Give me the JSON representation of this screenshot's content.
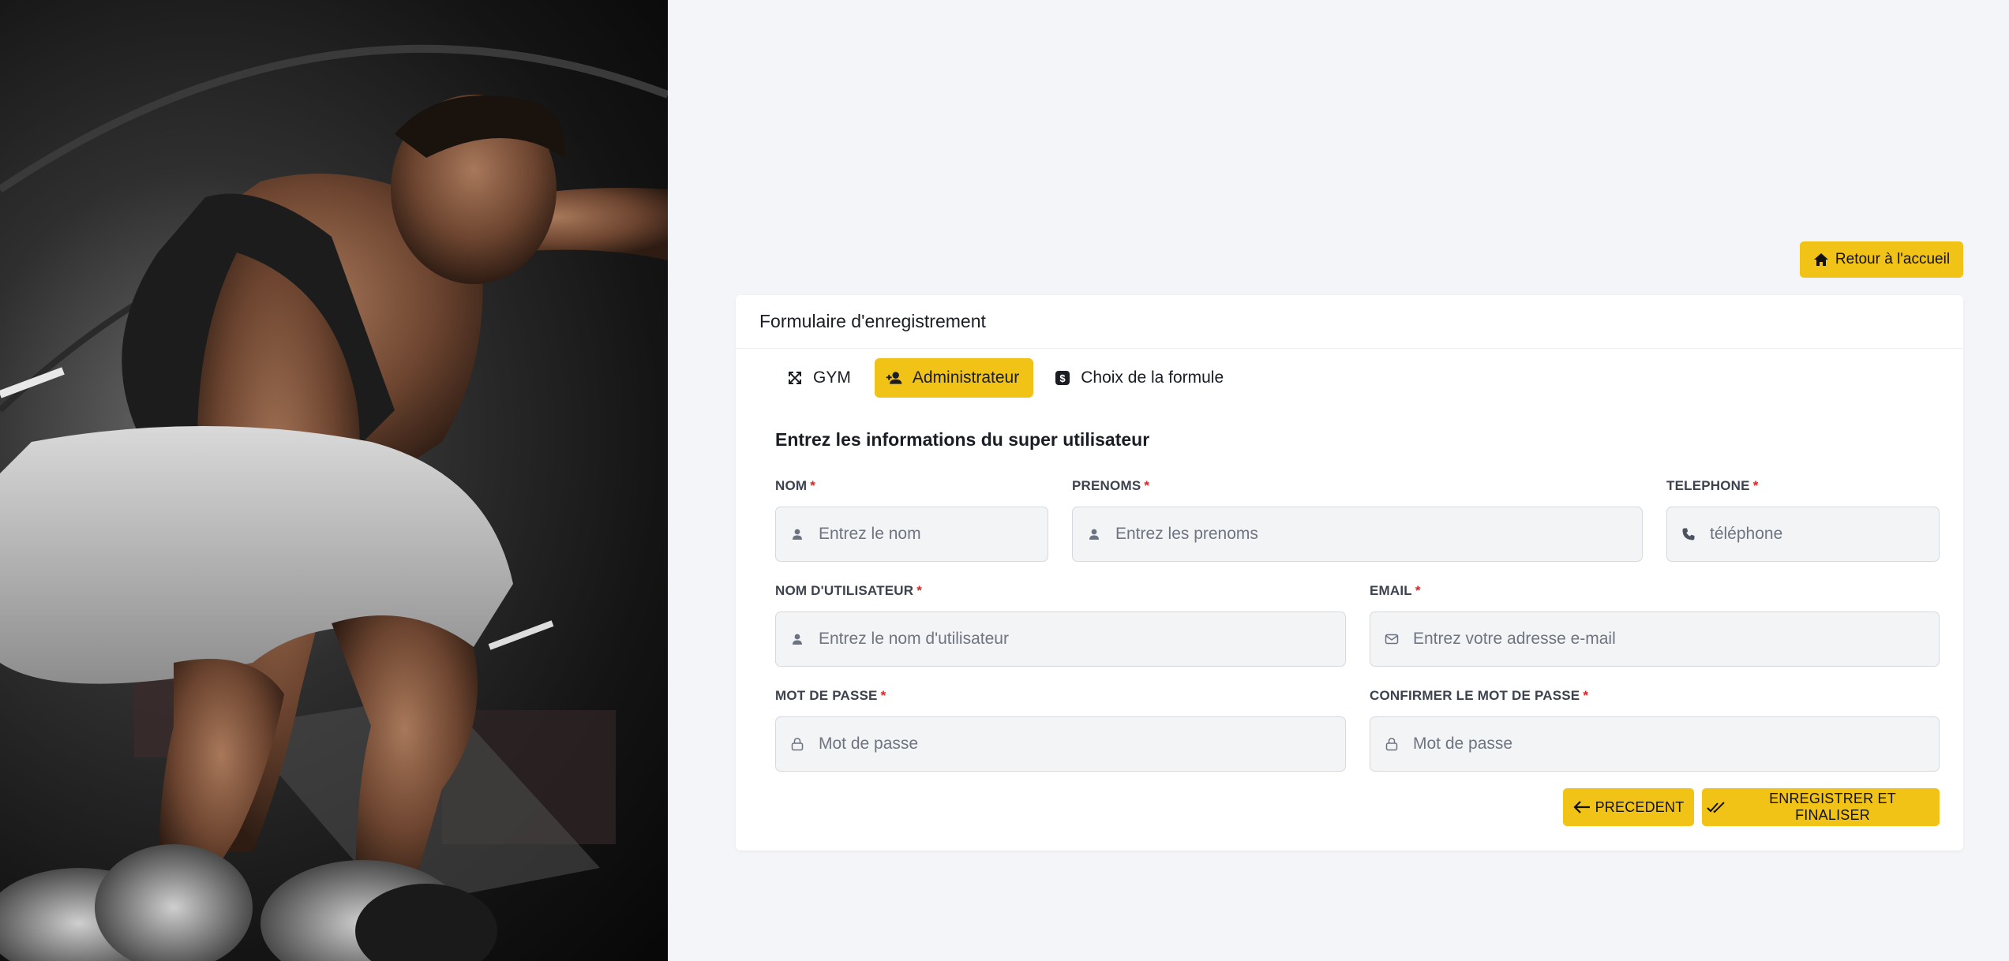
{
  "hero": {
    "icon": "gym-athlete-photo"
  },
  "home_button": {
    "label": "Retour à l'accueil",
    "icon": "home-icon"
  },
  "card": {
    "title": "Formulaire d'enregistrement",
    "tabs": [
      {
        "label": "GYM",
        "icon": "expand-arrows-icon",
        "active": false
      },
      {
        "label": "Administrateur",
        "icon": "user-add-icon",
        "active": true
      },
      {
        "label": "Choix de la formule",
        "icon": "dollar-icon",
        "active": false
      }
    ],
    "section_title": "Entrez les informations du super utilisateur",
    "fields": {
      "nom": {
        "label": "NOM",
        "placeholder": "Entrez le nom",
        "icon": "user-icon"
      },
      "prenoms": {
        "label": "PRENOMS",
        "placeholder": "Entrez les prenoms",
        "icon": "user-icon"
      },
      "telephone": {
        "label": "TELEPHONE",
        "placeholder": "téléphone",
        "icon": "phone-icon"
      },
      "username": {
        "label": "NOM D'UTILISATEUR",
        "placeholder": "Entrez le nom d'utilisateur",
        "icon": "user-icon"
      },
      "email": {
        "label": "EMAIL",
        "placeholder": "Entrez votre adresse e-mail",
        "icon": "mail-icon"
      },
      "password": {
        "label": "MOT DE PASSE",
        "placeholder": "Mot de passe",
        "icon": "lock-icon"
      },
      "confirm_password": {
        "label": "CONFIRMER LE MOT DE PASSE",
        "placeholder": "Mot de passe",
        "icon": "lock-icon"
      }
    },
    "required_marker": "*",
    "buttons": {
      "previous": "PRECEDENT",
      "finish": "ENREGISTRER ET FINALISER"
    }
  },
  "colors": {
    "accent": "#f2c317",
    "required": "#e02424",
    "background": "#f4f5f8"
  }
}
